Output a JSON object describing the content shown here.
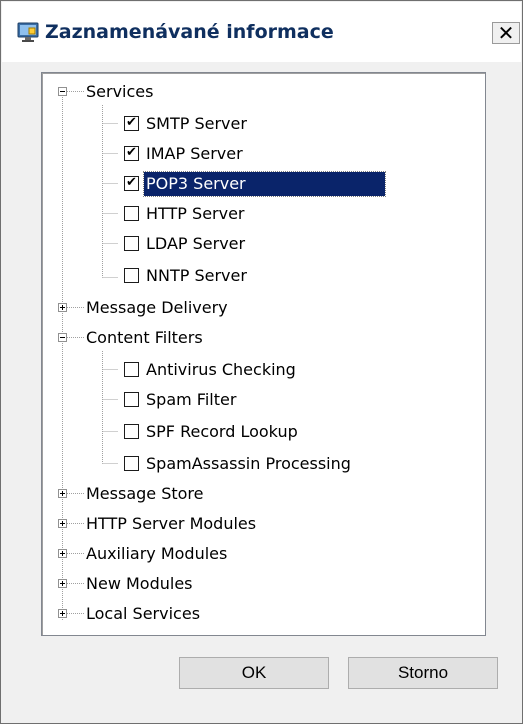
{
  "window": {
    "title": "Zaznamenávané informace",
    "close_glyph": "✕"
  },
  "tree": {
    "items": [
      {
        "label": "Services",
        "expanded": true
      },
      {
        "label": "SMTP Server",
        "checked": true
      },
      {
        "label": "IMAP Server",
        "checked": true
      },
      {
        "label": "POP3 Server",
        "checked": true,
        "selected": true
      },
      {
        "label": "HTTP Server",
        "checked": false
      },
      {
        "label": "LDAP Server",
        "checked": false
      },
      {
        "label": "NNTP Server",
        "checked": false
      },
      {
        "label": "Message Delivery",
        "expanded": false
      },
      {
        "label": "Content Filters",
        "expanded": true
      },
      {
        "label": "Antivirus Checking",
        "checked": false
      },
      {
        "label": "Spam Filter",
        "checked": false
      },
      {
        "label": "SPF Record Lookup",
        "checked": false
      },
      {
        "label": "SpamAssassin Processing",
        "checked": false
      },
      {
        "label": "Message Store",
        "expanded": false
      },
      {
        "label": "HTTP Server Modules",
        "expanded": false
      },
      {
        "label": "Auxiliary Modules",
        "expanded": false
      },
      {
        "label": "New Modules",
        "expanded": false
      },
      {
        "label": "Local Services",
        "expanded": false
      }
    ]
  },
  "buttons": {
    "ok_label": "OK",
    "cancel_label": "Storno"
  },
  "icons": {
    "app": "monitor-icon",
    "close": "close-icon"
  },
  "colors": {
    "selection": "#0a246a",
    "title_text": "#0f2f5f"
  }
}
